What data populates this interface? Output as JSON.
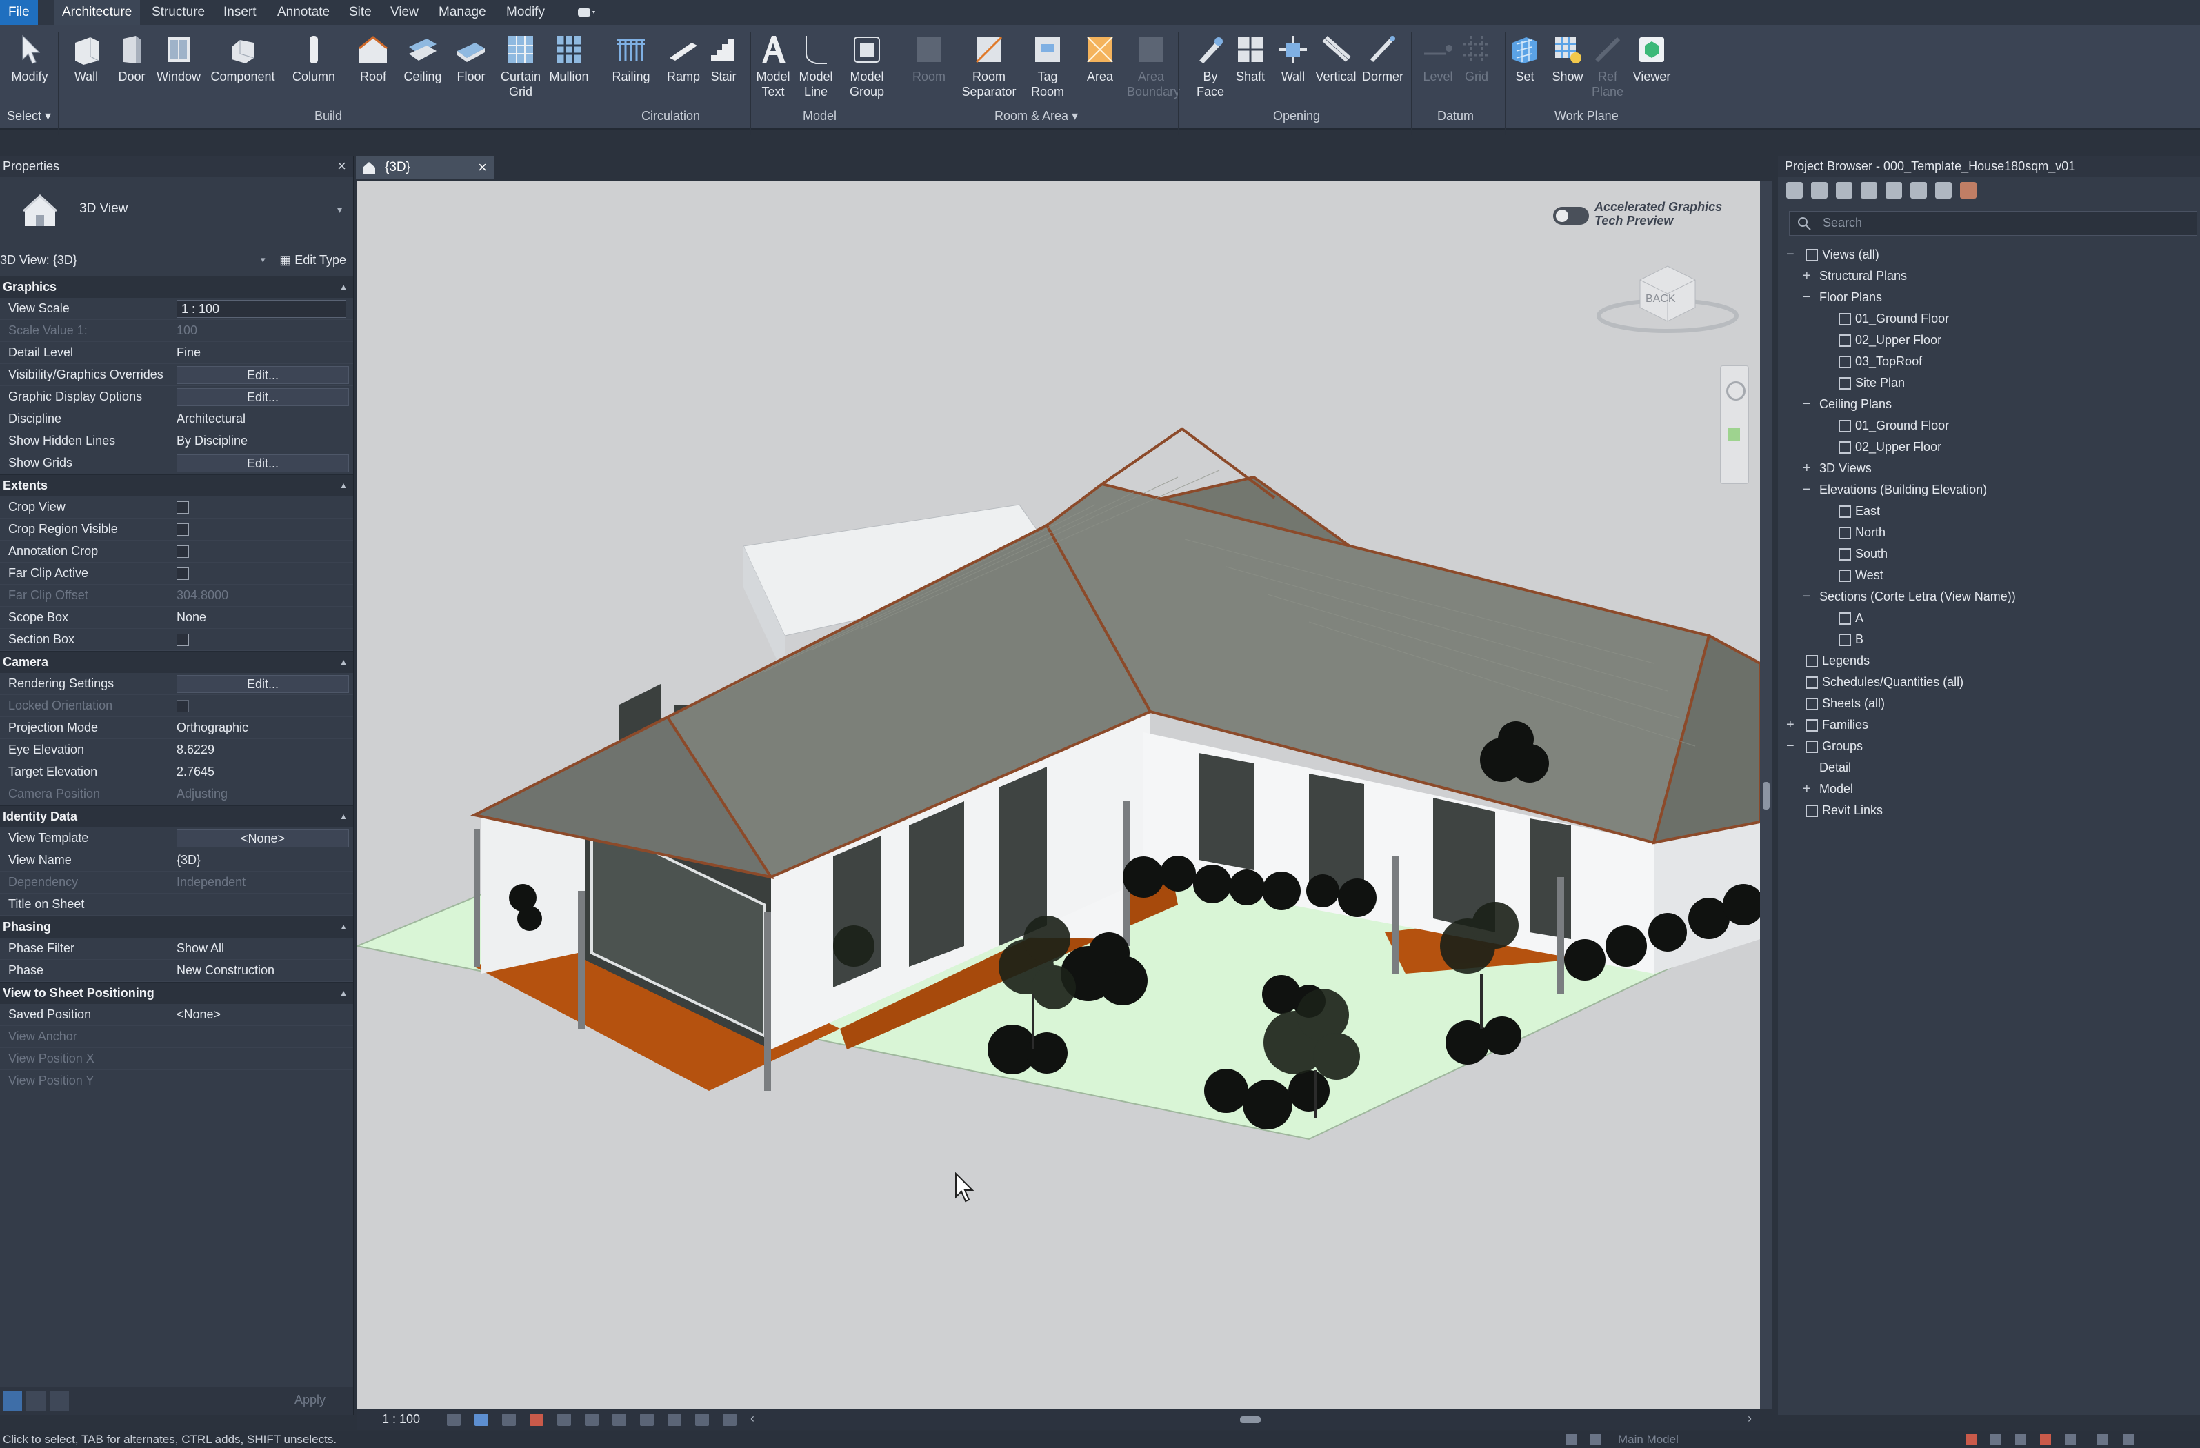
{
  "menu": {
    "tabs": [
      "File",
      "Architecture",
      "Structure",
      "Insert",
      "Annotate",
      "Site",
      "View",
      "Manage",
      "Modify"
    ],
    "active": "Architecture"
  },
  "ribbon": {
    "select_label": "Select",
    "groups": [
      "Build",
      "Circulation",
      "Model",
      "Room & Area",
      "Opening",
      "Datum",
      "Work Plane"
    ],
    "tools": [
      {
        "label": "Modify",
        "icon": "cursor-icon"
      },
      {
        "label": "Wall",
        "icon": "wall-icon"
      },
      {
        "label": "Door",
        "icon": "door-icon"
      },
      {
        "label": "Window",
        "icon": "window-icon"
      },
      {
        "label": "Component",
        "icon": "component-icon"
      },
      {
        "label": "Column",
        "icon": "column-icon"
      },
      {
        "label": "Roof",
        "icon": "roof-icon"
      },
      {
        "label": "Ceiling",
        "icon": "ceiling-icon"
      },
      {
        "label": "Floor",
        "icon": "floor-icon"
      },
      {
        "label": "Curtain\nGrid",
        "icon": "curtain-grid-icon"
      },
      {
        "label": "Mullion",
        "icon": "mullion-icon"
      },
      {
        "label": "Railing",
        "icon": "railing-icon"
      },
      {
        "label": "Ramp",
        "icon": "ramp-icon"
      },
      {
        "label": "Stair",
        "icon": "stair-icon"
      },
      {
        "label": "Model\nText",
        "icon": "model-text-icon"
      },
      {
        "label": "Model\nLine",
        "icon": "model-line-icon"
      },
      {
        "label": "Model\nGroup",
        "icon": "model-group-icon"
      },
      {
        "label": "Room",
        "icon": "room-icon"
      },
      {
        "label": "Room\nSeparator",
        "icon": "room-separator-icon"
      },
      {
        "label": "Tag\nRoom",
        "icon": "tag-room-icon"
      },
      {
        "label": "Area",
        "icon": "area-icon"
      },
      {
        "label": "Area\nBoundary",
        "icon": "area-boundary-icon"
      },
      {
        "label": "By\nFace",
        "icon": "by-face-icon"
      },
      {
        "label": "Shaft",
        "icon": "shaft-icon"
      },
      {
        "label": "Wall",
        "icon": "wall-opening-icon"
      },
      {
        "label": "Vertical",
        "icon": "vertical-icon"
      },
      {
        "label": "Dormer",
        "icon": "dormer-icon"
      },
      {
        "label": "Level",
        "icon": "level-icon"
      },
      {
        "label": "Grid",
        "icon": "grid-icon"
      },
      {
        "label": "Set",
        "icon": "set-icon"
      },
      {
        "label": "Show",
        "icon": "show-icon"
      },
      {
        "label": "Ref\nPlane",
        "icon": "ref-plane-icon"
      },
      {
        "label": "Viewer",
        "icon": "viewer-icon"
      }
    ]
  },
  "properties": {
    "title": "Properties",
    "type_name": "3D View",
    "view_selector": "3D View: {3D}",
    "edit_type": "Edit Type",
    "apply": "Apply",
    "sections": [
      {
        "name": "Graphics",
        "rows": [
          {
            "k": "View Scale",
            "v": "1 : 100",
            "kind": "box"
          },
          {
            "k": "Scale Value    1:",
            "v": "100",
            "dim": true
          },
          {
            "k": "Detail Level",
            "v": "Fine"
          },
          {
            "k": "Visibility/Graphics Overrides",
            "v": "Edit...",
            "kind": "btn"
          },
          {
            "k": "Graphic Display Options",
            "v": "Edit...",
            "kind": "btn"
          },
          {
            "k": "Discipline",
            "v": "Architectural"
          },
          {
            "k": "Show Hidden Lines",
            "v": "By Discipline"
          },
          {
            "k": "Show Grids",
            "v": "Edit...",
            "kind": "btn"
          }
        ]
      },
      {
        "name": "Extents",
        "rows": [
          {
            "k": "Crop View",
            "v": "",
            "kind": "chk"
          },
          {
            "k": "Crop Region Visible",
            "v": "",
            "kind": "chk"
          },
          {
            "k": "Annotation Crop",
            "v": "",
            "kind": "chk"
          },
          {
            "k": "Far Clip Active",
            "v": "",
            "kind": "chk"
          },
          {
            "k": "Far Clip Offset",
            "v": "304.8000",
            "dim": true
          },
          {
            "k": "Scope Box",
            "v": "None"
          },
          {
            "k": "Section Box",
            "v": "",
            "kind": "chk"
          }
        ]
      },
      {
        "name": "Camera",
        "rows": [
          {
            "k": "Rendering Settings",
            "v": "Edit...",
            "kind": "btn"
          },
          {
            "k": "Locked Orientation",
            "v": "",
            "kind": "chk",
            "dim": true
          },
          {
            "k": "Projection Mode",
            "v": "Orthographic"
          },
          {
            "k": "Eye Elevation",
            "v": "8.6229"
          },
          {
            "k": "Target Elevation",
            "v": "2.7645"
          },
          {
            "k": "Camera Position",
            "v": "Adjusting",
            "dim": true
          }
        ]
      },
      {
        "name": "Identity Data",
        "rows": [
          {
            "k": "View Template",
            "v": "<None>",
            "kind": "btn"
          },
          {
            "k": "View Name",
            "v": "{3D}"
          },
          {
            "k": "Dependency",
            "v": "Independent",
            "dim": true
          },
          {
            "k": "Title on Sheet",
            "v": ""
          }
        ]
      },
      {
        "name": "Phasing",
        "rows": [
          {
            "k": "Phase Filter",
            "v": "Show All"
          },
          {
            "k": "Phase",
            "v": "New Construction"
          }
        ]
      },
      {
        "name": "View to Sheet Positioning",
        "rows": [
          {
            "k": "Saved Position",
            "v": "<None>"
          },
          {
            "k": "View Anchor",
            "v": "",
            "dim": true
          },
          {
            "k": "View Position X",
            "v": "",
            "dim": true
          },
          {
            "k": "View Position Y",
            "v": "",
            "dim": true
          }
        ]
      }
    ]
  },
  "view": {
    "tab_label": "{3D}",
    "scale": "1 : 100",
    "accel_line1": "Accelerated Graphics",
    "accel_line2": "Tech Preview",
    "viewcube_label": "BACK"
  },
  "browser": {
    "title": "Project Browser - 000_Template_House180sqm_v01",
    "search_placeholder": "Search",
    "tree": [
      {
        "label": "Views (all)",
        "level": 0,
        "exp": "−",
        "icon": true
      },
      {
        "label": "Structural Plans",
        "level": 1,
        "exp": "+"
      },
      {
        "label": "Floor Plans",
        "level": 1,
        "exp": "−"
      },
      {
        "label": "01_Ground Floor",
        "level": 2,
        "icon": true
      },
      {
        "label": "02_Upper Floor",
        "level": 2,
        "icon": true
      },
      {
        "label": "03_TopRoof",
        "level": 2,
        "icon": true
      },
      {
        "label": "Site Plan",
        "level": 2,
        "icon": true
      },
      {
        "label": "Ceiling Plans",
        "level": 1,
        "exp": "−"
      },
      {
        "label": "01_Ground Floor",
        "level": 2,
        "icon": true
      },
      {
        "label": "02_Upper Floor",
        "level": 2,
        "icon": true
      },
      {
        "label": "3D Views",
        "level": 1,
        "exp": "+"
      },
      {
        "label": "Elevations (Building Elevation)",
        "level": 1,
        "exp": "−"
      },
      {
        "label": "East",
        "level": 2,
        "icon": true
      },
      {
        "label": "North",
        "level": 2,
        "icon": true
      },
      {
        "label": "South",
        "level": 2,
        "icon": true
      },
      {
        "label": "West",
        "level": 2,
        "icon": true
      },
      {
        "label": "Sections (Corte Letra (View Name))",
        "level": 1,
        "exp": "−"
      },
      {
        "label": "A",
        "level": 2,
        "icon": true
      },
      {
        "label": "B",
        "level": 2,
        "icon": true
      },
      {
        "label": "Legends",
        "level": 0,
        "icon": true
      },
      {
        "label": "Schedules/Quantities (all)",
        "level": 0,
        "icon": true
      },
      {
        "label": "Sheets (all)",
        "level": 0,
        "icon": true
      },
      {
        "label": "Families",
        "level": 0,
        "exp": "+",
        "icon": true
      },
      {
        "label": "Groups",
        "level": 0,
        "exp": "−",
        "icon": true
      },
      {
        "label": "Detail",
        "level": 1
      },
      {
        "label": "Model",
        "level": 1,
        "exp": "+"
      },
      {
        "label": "Revit Links",
        "level": 0,
        "icon": true
      }
    ]
  },
  "status": {
    "message": "Click to select, TAB for alternates, CTRL adds, SHIFT unselects.",
    "model": "Main Model"
  },
  "colors": {
    "accent": "#1f6fbf",
    "ground": "#d9f5d6",
    "deck": "#b5520f",
    "roof": "#7c8079"
  }
}
